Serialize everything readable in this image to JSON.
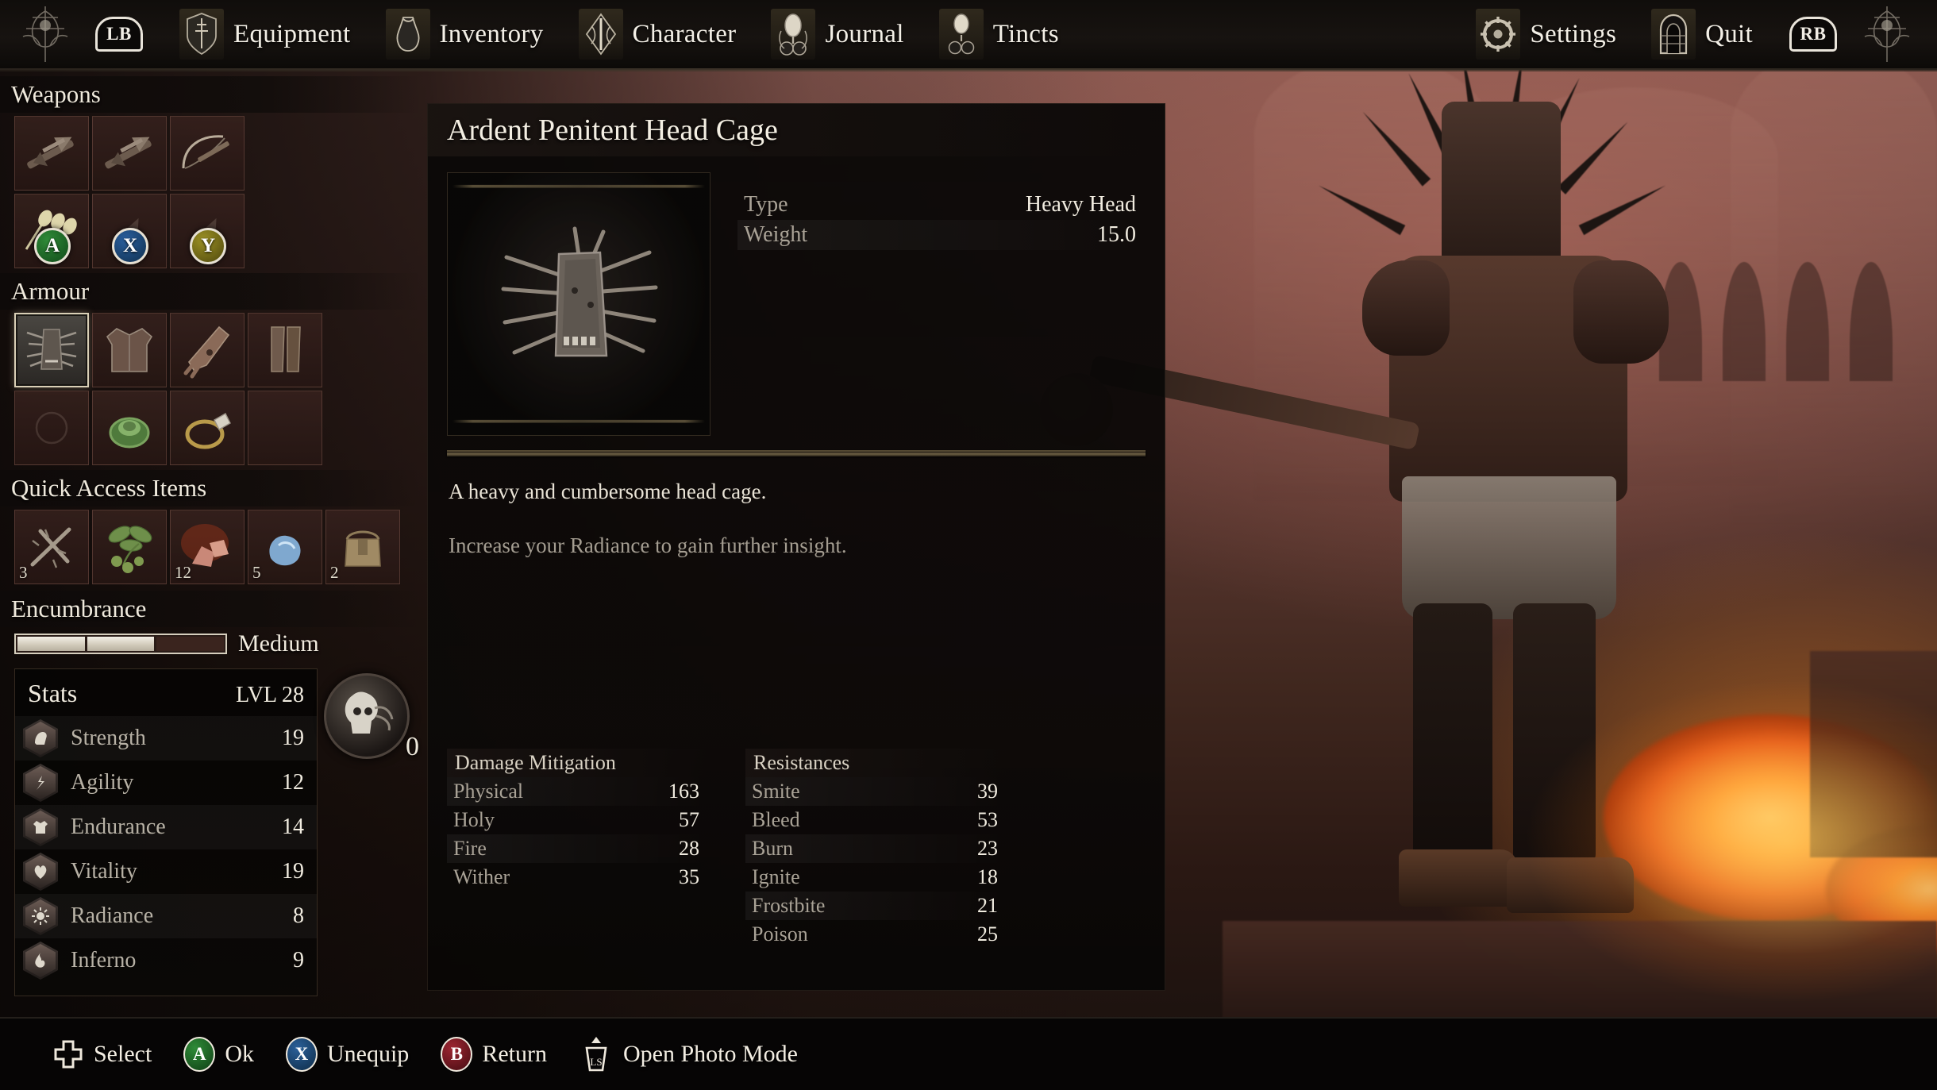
{
  "topbar": {
    "left_bumper": "LB",
    "right_bumper": "RB",
    "tabs": [
      {
        "label": "Equipment",
        "icon": "shield-sword-icon",
        "active": true
      },
      {
        "label": "Inventory",
        "icon": "pouch-icon",
        "active": false
      },
      {
        "label": "Character",
        "icon": "character-crest-icon",
        "active": false
      },
      {
        "label": "Journal",
        "icon": "journal-lantern-icon",
        "active": false
      },
      {
        "label": "Tincts",
        "icon": "tinct-vial-icon",
        "active": false
      }
    ],
    "right_items": [
      {
        "label": "Settings",
        "icon": "gear-icon"
      },
      {
        "label": "Quit",
        "icon": "doorway-icon"
      }
    ]
  },
  "sidebar": {
    "weapons": {
      "title": "Weapons",
      "slots": [
        {
          "name": "crossbow-pistol",
          "icon": "crossbow",
          "qty": "",
          "button": "",
          "empty": false
        },
        {
          "name": "crossbow-pistol-2",
          "icon": "crossbow",
          "qty": "",
          "button": "",
          "empty": false
        },
        {
          "name": "longbow",
          "icon": "bow",
          "qty": "",
          "button": "",
          "empty": false
        },
        {
          "name": "arrows",
          "icon": "arrows",
          "qty": "",
          "button": "A",
          "empty": false
        },
        {
          "name": "empty-ammo-slot-x",
          "icon": "",
          "qty": "",
          "button": "X",
          "empty": true
        },
        {
          "name": "empty-ammo-slot-y",
          "icon": "",
          "qty": "",
          "button": "Y",
          "empty": true
        }
      ]
    },
    "armour": {
      "title": "Armour",
      "slots": [
        {
          "name": "head-cage",
          "icon": "helm",
          "qty": "",
          "selected": true,
          "empty": false
        },
        {
          "name": "chest-armour",
          "icon": "chest",
          "qty": "",
          "selected": false,
          "empty": false
        },
        {
          "name": "gauntlets",
          "icon": "gauntlet",
          "qty": "",
          "selected": false,
          "empty": false
        },
        {
          "name": "leg-armour",
          "icon": "legs",
          "qty": "",
          "selected": false,
          "empty": false
        },
        {
          "name": "empty-amulet-slot",
          "icon": "",
          "qty": "",
          "selected": false,
          "empty": true
        },
        {
          "name": "green-ring",
          "icon": "ring-green",
          "qty": "",
          "selected": false,
          "empty": false
        },
        {
          "name": "gold-ring",
          "icon": "ring-gold",
          "qty": "",
          "selected": false,
          "empty": false
        },
        {
          "name": "empty-ring-slot",
          "icon": "",
          "qty": "",
          "selected": false,
          "empty": true
        }
      ]
    },
    "quick_access": {
      "title": "Quick Access Items",
      "slots": [
        {
          "name": "thorn-relic",
          "icon": "thorn",
          "qty": "3"
        },
        {
          "name": "herb-bundle",
          "icon": "herb",
          "qty": ""
        },
        {
          "name": "ember-shards",
          "icon": "ember",
          "qty": "12"
        },
        {
          "name": "frost-crystal",
          "icon": "frost",
          "qty": "5"
        },
        {
          "name": "satchel",
          "icon": "satchel",
          "qty": "2"
        }
      ]
    },
    "encumbrance": {
      "title": "Encumbrance",
      "segments": [
        true,
        true,
        false
      ],
      "status": "Medium"
    },
    "stats": {
      "title": "Stats",
      "level_label": "LVL 28",
      "rows": [
        {
          "icon": "strength-icon",
          "name": "Strength",
          "value": "19"
        },
        {
          "icon": "agility-icon",
          "name": "Agility",
          "value": "12"
        },
        {
          "icon": "endurance-icon",
          "name": "Endurance",
          "value": "14"
        },
        {
          "icon": "vitality-icon",
          "name": "Vitality",
          "value": "19"
        },
        {
          "icon": "radiance-icon",
          "name": "Radiance",
          "value": "8"
        },
        {
          "icon": "inferno-icon",
          "name": "Inferno",
          "value": "9"
        }
      ]
    },
    "emblem": {
      "icon": "skull-vigor-icon",
      "count": "0"
    }
  },
  "item": {
    "title": "Ardent Penitent Head Cage",
    "icon": "spiked-head-cage-icon",
    "properties": [
      {
        "key": "Type",
        "value": "Heavy Head"
      },
      {
        "key": "Weight",
        "value": "15.0"
      }
    ],
    "description_primary": "A heavy and cumbersome head cage.",
    "description_secondary": "Increase your Radiance to gain further insight.",
    "damage_mitigation": {
      "title": "Damage Mitigation",
      "rows": [
        {
          "key": "Physical",
          "value": "163"
        },
        {
          "key": "Holy",
          "value": "57"
        },
        {
          "key": "Fire",
          "value": "28"
        },
        {
          "key": "Wither",
          "value": "35"
        }
      ]
    },
    "resistances": {
      "title": "Resistances",
      "rows": [
        {
          "key": "Smite",
          "value": "39"
        },
        {
          "key": "Bleed",
          "value": "53"
        },
        {
          "key": "Burn",
          "value": "23"
        },
        {
          "key": "Ignite",
          "value": "18"
        },
        {
          "key": "Frostbite",
          "value": "21"
        },
        {
          "key": "Poison",
          "value": "25"
        }
      ]
    }
  },
  "bottombar": {
    "hints": [
      {
        "button": "dpad",
        "label": "Select"
      },
      {
        "button": "A",
        "label": "Ok"
      },
      {
        "button": "X",
        "label": "Unequip"
      },
      {
        "button": "B",
        "label": "Return"
      },
      {
        "button": "LS",
        "label": "Open Photo Mode"
      }
    ]
  },
  "colors": {
    "accent_a": "#2f8b38",
    "accent_x": "#2a5f9e",
    "accent_y": "#9c9124",
    "accent_b": "#9c2530",
    "panel_bg": "#0a0807",
    "text_primary": "#f1ece0",
    "text_muted": "#a9a296"
  }
}
